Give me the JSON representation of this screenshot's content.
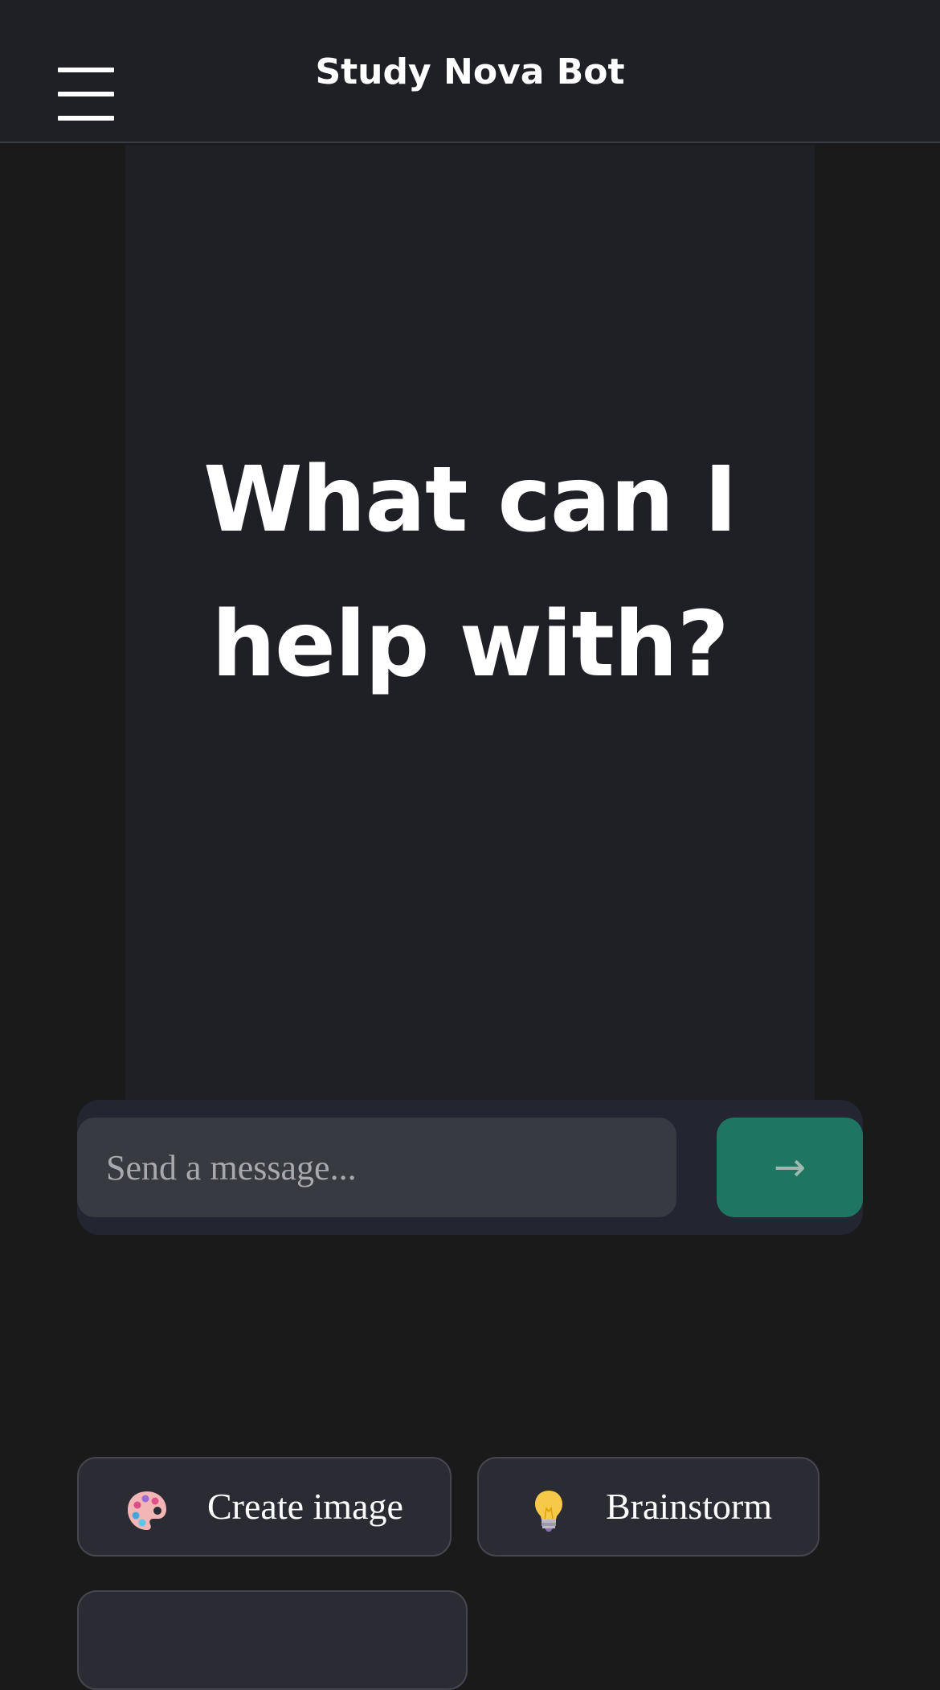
{
  "header": {
    "title": "Study Nova Bot"
  },
  "main": {
    "heading_line1": "What can I",
    "heading_line2": "help with?"
  },
  "composer": {
    "placeholder": "Send a message...",
    "value": "",
    "send_label": "→",
    "send_color": "#1e7560"
  },
  "suggestions": [
    {
      "label": "Create image",
      "icon": "palette-icon"
    },
    {
      "label": "Brainstorm",
      "icon": "lightbulb-icon"
    }
  ],
  "colors": {
    "background": "#1a1a1b",
    "panel": "#1f2025",
    "input": "#383a42",
    "chip": "#2b2c33"
  }
}
